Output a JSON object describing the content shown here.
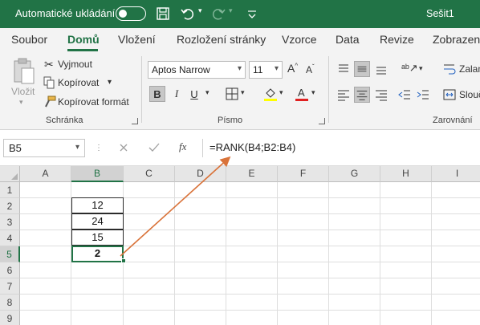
{
  "titlebar": {
    "autosave_label": "Automatické ukládání",
    "document_name": "Sešit1",
    "accent_color": "#217346"
  },
  "tabs": [
    {
      "label": "Soubor"
    },
    {
      "label": "Domů"
    },
    {
      "label": "Vložení"
    },
    {
      "label": "Rozložení stránky"
    },
    {
      "label": "Vzorce"
    },
    {
      "label": "Data"
    },
    {
      "label": "Revize"
    },
    {
      "label": "Zobrazení"
    }
  ],
  "ribbon": {
    "clipboard": {
      "paste_label": "Vložit",
      "cut_label": "Vyjmout",
      "copy_label": "Kopírovat",
      "format_painter_label": "Kopírovat formát",
      "group_label": "Schránka"
    },
    "font": {
      "font_name": "Aptos Narrow",
      "font_size": "11",
      "bold": "B",
      "italic": "I",
      "underline": "U",
      "group_label": "Písmo"
    },
    "alignment": {
      "wrap_label": "Zalam",
      "merge_label": "Slouč",
      "group_label": "Zarovnání"
    }
  },
  "formula_bar": {
    "name_box": "B5",
    "fx": "fx",
    "formula": "=RANK(B4;B2:B4)"
  },
  "grid": {
    "columns": [
      "A",
      "B",
      "C",
      "D",
      "E",
      "F",
      "G",
      "H",
      "I"
    ],
    "rows": [
      "1",
      "2",
      "3",
      "4",
      "5",
      "6",
      "7",
      "8",
      "9"
    ],
    "cells": {
      "B2": "12",
      "B3": "24",
      "B4": "15",
      "B5": "2"
    },
    "active_cell": "B5",
    "annotation_arrow_color": "#d9733a"
  }
}
